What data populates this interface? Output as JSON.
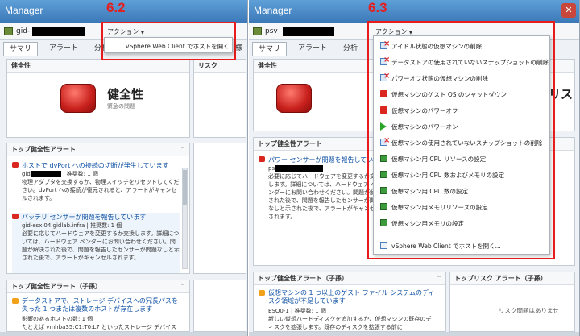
{
  "app_title": "Manager",
  "colors": {
    "annotation": "#e81c1c",
    "alarm_critical": "#d9261e",
    "alarm_warning": "#f1a21a",
    "link": "#0b4ea2"
  },
  "left": {
    "host_prefix": "gid-",
    "actions_label": "アクション",
    "step": "6.2",
    "tabs": [
      "サマリ",
      "アラート",
      "分析"
    ],
    "tab_overflow": "様",
    "actions_dropdown_item": "vSphere Web Client でホストを開く...",
    "health_panel": {
      "title": "健全性",
      "badge_label": "健全性",
      "badge_sub": "緊急の問題"
    },
    "risk_panel_title": "リスク",
    "top_alerts_panel": {
      "title": "トップ健全性アラート",
      "alarms": [
        {
          "title": "ホストで dvPort への接続の切断が発生しています",
          "detail_prefix": "gid",
          "detail_suffix": " | 推奨数: 1 個",
          "body": "物理アダプタを交換するか、物理スイッチをリセットしてください。dvPort への接続が復元されると、アラートがキャンセルされます。"
        },
        {
          "title": "バッテリ センサーが問題を報告しています",
          "detail": "gid-esxi04.gidlab.infra | 推奨数: 1 個",
          "body": "必要に応じてハードウェアを変更するか交換します。詳細については、ハードウェア ベンダーにお問い合わせください。問題が解決された後で、問題を報告したセンサーが問題なしと示された後で、アラートがキャンセルされます。"
        }
      ]
    },
    "child_alerts_panel": {
      "title": "トップ健全性アラート（子孫）",
      "alarms": [
        {
          "title": "データストアで、ストレージ デバイスへの冗長パスを失った 1 つまたは複数のホストが存在します",
          "body": "影響のあるホストの数: 1 個\nたとえば vmhba35:C1:T0:L7 といったストレージ デバイス"
        }
      ]
    }
  },
  "right": {
    "host_prefix": "psv",
    "actions_label": "アクション",
    "step": "6.3",
    "tabs": [
      "サマリ",
      "アラート",
      "分析"
    ],
    "health_panel_title": "健全性",
    "health_cut_label": "リス",
    "top_alerts_title": "トップ健全性アラート",
    "top_alarm": {
      "title": "パワー センサーが問題を報告しています",
      "detail_prefix": "ps",
      "body": "必要に応じてハードウェアを変更するか交換します。詳細については、ハードウェア ベンダーにお問い合わせください。問題が解決された後で、問題を報告したセンサーが問題なしと示された後で、アラートがキャンセルされます。"
    },
    "child_alerts_title": "トップ健全性アラート（子孫）",
    "child_alarm": {
      "title": "仮想マシンの 1 つ以上のゲスト ファイル システムのディスク領域が不足しています",
      "detail": "ESO0-1 | 推奨数: 1 個",
      "body": "新しい仮想ハードディスクを追加するか、仮想マシンの既存のディスクを拡張します。既存のディスクを拡張する前に"
    },
    "risk_child_title": "トップリスク アラート（子孫）",
    "risk_child_empty": "リスク問題はありませ",
    "actions_dropdown": [
      {
        "label": "アイドル状態の仮想マシンの削除",
        "icon": "vm-delete-icon"
      },
      {
        "label": "データストアの使用されていないスナップショットの削除",
        "icon": "snapshot-delete-icon"
      },
      {
        "label": "パワーオフ状態の仮想マシンの削除",
        "icon": "vm-delete-icon"
      },
      {
        "label": "仮想マシンのゲスト OS のシャットダウン",
        "icon": "stop-icon"
      },
      {
        "label": "仮想マシンのパワーオフ",
        "icon": "stop-icon"
      },
      {
        "label": "仮想マシンのパワーオン",
        "icon": "play-icon"
      },
      {
        "label": "仮想マシンの使用されていないスナップショットの削除",
        "icon": "snapshot-delete-icon"
      },
      {
        "label": "仮想マシン用 CPU リソースの設定",
        "icon": "cpu-icon"
      },
      {
        "label": "仮想マシン用 CPU 数およびメモリの設定",
        "icon": "cpu-memory-icon"
      },
      {
        "label": "仮想マシン用 CPU 数の設定",
        "icon": "cpu-icon"
      },
      {
        "label": "仮想マシン用メモリリソースの設定",
        "icon": "memory-icon"
      },
      {
        "label": "仮想マシン用メモリの設定",
        "icon": "memory-icon"
      },
      {
        "label": "vSphere Web Client でホストを開く...",
        "icon": "web-client-icon"
      }
    ]
  }
}
